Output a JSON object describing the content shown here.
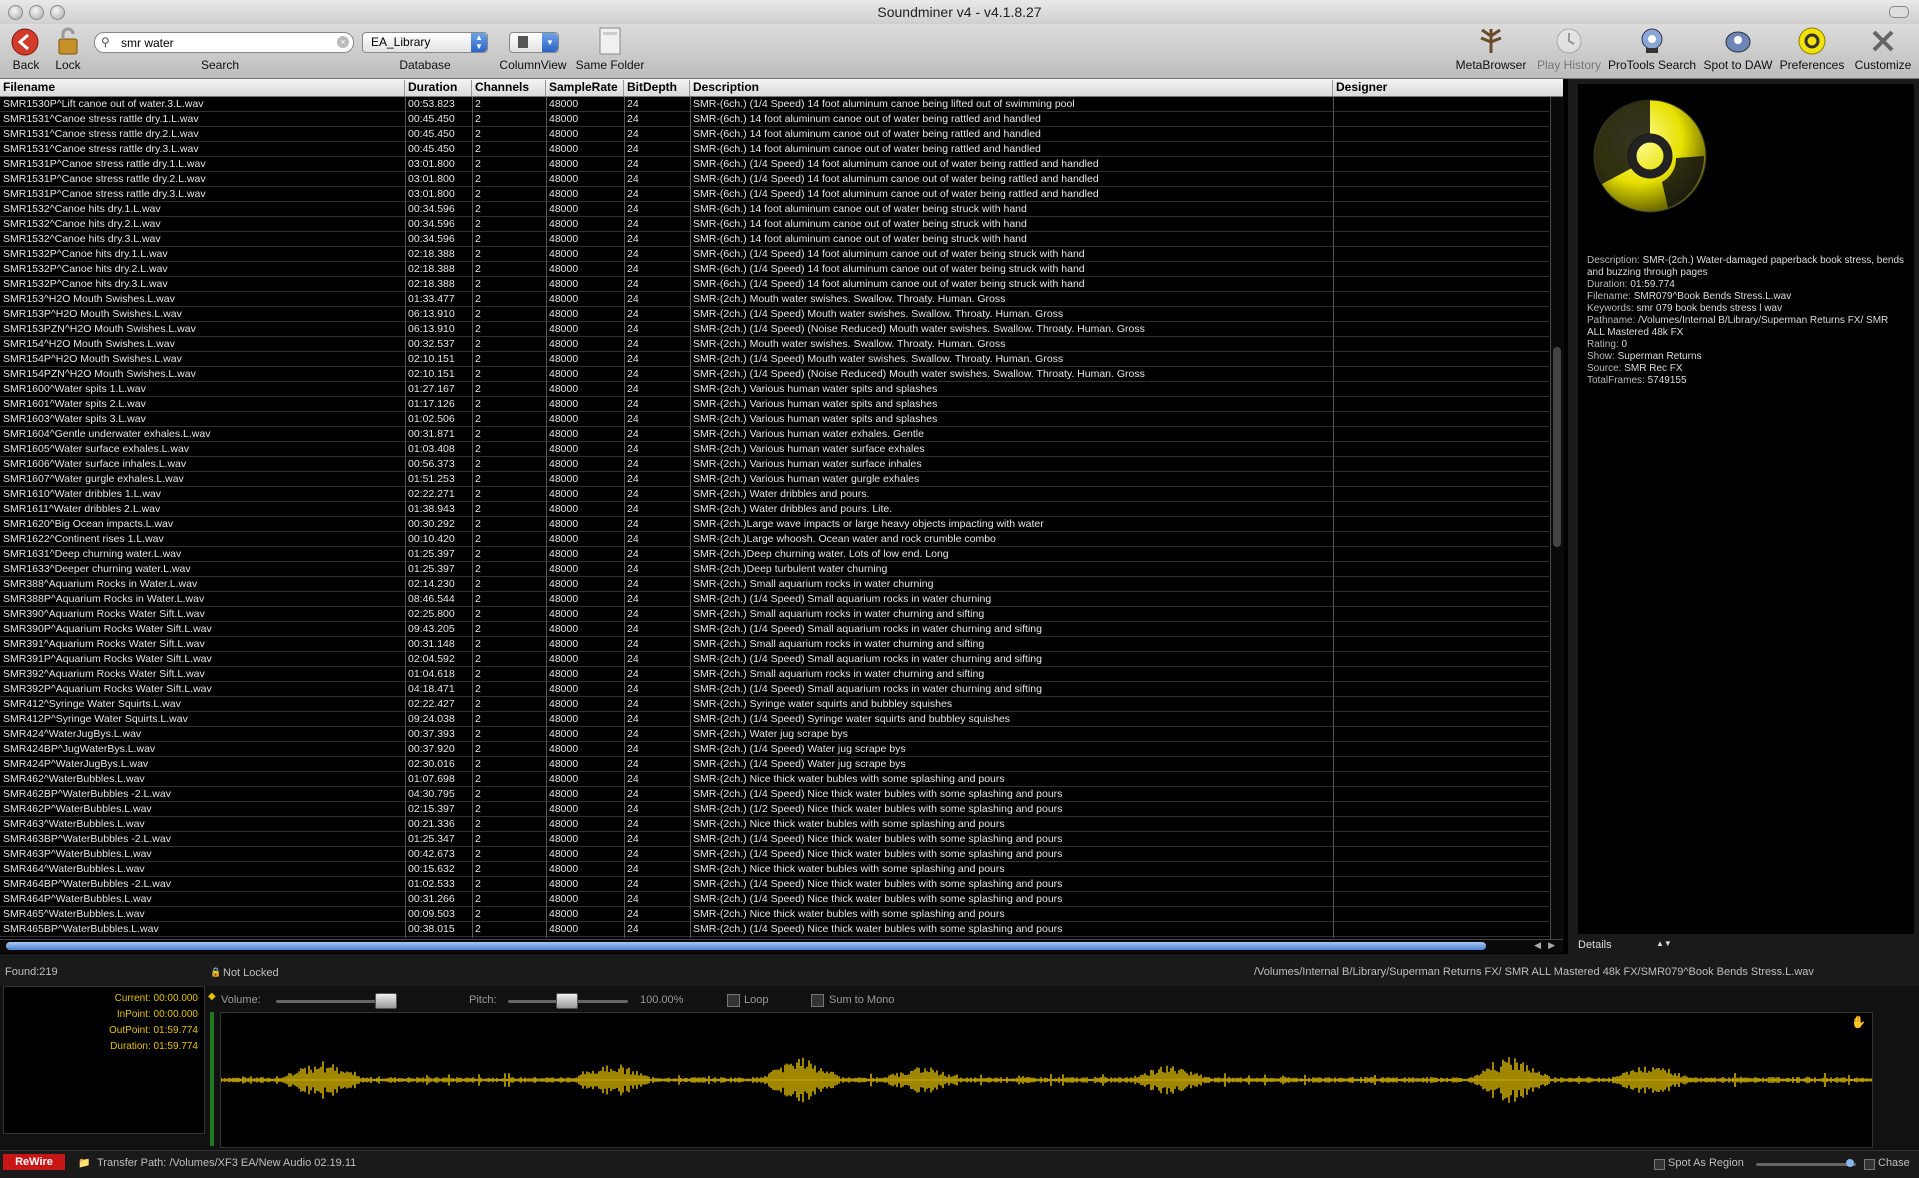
{
  "window": {
    "title": "Soundminer v4 - v4.1.8.27"
  },
  "toolbar": {
    "back_label": "Back",
    "lock_label": "Lock",
    "search_label": "Search",
    "search_value": "smr water",
    "database_label": "Database",
    "database_value": "EA_Library",
    "columnview_label": "ColumnView",
    "samefolder_label": "Same Folder",
    "metabrowser_label": "MetaBrowser",
    "playhistory_label": "Play History",
    "protools_label": "ProTools Search",
    "spottodaw_label": "Spot to DAW",
    "preferences_label": "Preferences",
    "customize_label": "Customize"
  },
  "columns": [
    "Filename",
    "Duration",
    "Channels",
    "SampleRate",
    "BitDepth",
    "Description",
    "Designer"
  ],
  "rows": [
    [
      "SMR1530P^Lift canoe out of water.3.L.wav",
      "00:53.823",
      "2",
      "48000",
      "24",
      "SMR-(6ch.) (1/4 Speed) 14 foot aluminum canoe being lifted out of swimming pool"
    ],
    [
      "SMR1531^Canoe stress rattle dry.1.L.wav",
      "00:45.450",
      "2",
      "48000",
      "24",
      "SMR-(6ch.) 14 foot aluminum canoe out of water being rattled and handled"
    ],
    [
      "SMR1531^Canoe stress rattle dry.2.L.wav",
      "00:45.450",
      "2",
      "48000",
      "24",
      "SMR-(6ch.) 14 foot aluminum canoe out of water being rattled and handled"
    ],
    [
      "SMR1531^Canoe stress rattle dry.3.L.wav",
      "00:45.450",
      "2",
      "48000",
      "24",
      "SMR-(6ch.) 14 foot aluminum canoe out of water being rattled and handled"
    ],
    [
      "SMR1531P^Canoe stress rattle dry.1.L.wav",
      "03:01.800",
      "2",
      "48000",
      "24",
      "SMR-(6ch.) (1/4 Speed) 14 foot aluminum canoe out of water being rattled and handled"
    ],
    [
      "SMR1531P^Canoe stress rattle dry.2.L.wav",
      "03:01.800",
      "2",
      "48000",
      "24",
      "SMR-(6ch.) (1/4 Speed) 14 foot aluminum canoe out of water being rattled and handled"
    ],
    [
      "SMR1531P^Canoe stress rattle dry.3.L.wav",
      "03:01.800",
      "2",
      "48000",
      "24",
      "SMR-(6ch.) (1/4 Speed) 14 foot aluminum canoe out of water being rattled and handled"
    ],
    [
      "SMR1532^Canoe hits dry.1.L.wav",
      "00:34.596",
      "2",
      "48000",
      "24",
      "SMR-(6ch.) 14 foot aluminum canoe out of water being struck with hand"
    ],
    [
      "SMR1532^Canoe hits dry.2.L.wav",
      "00:34.596",
      "2",
      "48000",
      "24",
      "SMR-(6ch.) 14 foot aluminum canoe out of water being struck with hand"
    ],
    [
      "SMR1532^Canoe hits dry.3.L.wav",
      "00:34.596",
      "2",
      "48000",
      "24",
      "SMR-(6ch.) 14 foot aluminum canoe out of water being struck with hand"
    ],
    [
      "SMR1532P^Canoe hits dry.1.L.wav",
      "02:18.388",
      "2",
      "48000",
      "24",
      "SMR-(6ch.) (1/4 Speed) 14 foot aluminum canoe out of water being struck with hand"
    ],
    [
      "SMR1532P^Canoe hits dry.2.L.wav",
      "02:18.388",
      "2",
      "48000",
      "24",
      "SMR-(6ch.) (1/4 Speed) 14 foot aluminum canoe out of water being struck with hand"
    ],
    [
      "SMR1532P^Canoe hits dry.3.L.wav",
      "02:18.388",
      "2",
      "48000",
      "24",
      "SMR-(6ch.) (1/4 Speed) 14 foot aluminum canoe out of water being struck with hand"
    ],
    [
      "SMR153^H2O Mouth Swishes.L.wav",
      "01:33.477",
      "2",
      "48000",
      "24",
      "SMR-(2ch.) Mouth water swishes. Swallow. Throaty. Human. Gross"
    ],
    [
      "SMR153P^H2O Mouth Swishes.L.wav",
      "06:13.910",
      "2",
      "48000",
      "24",
      "SMR-(2ch.) (1/4 Speed) Mouth water swishes. Swallow. Throaty. Human. Gross"
    ],
    [
      "SMR153PZN^H2O Mouth Swishes.L.wav",
      "06:13.910",
      "2",
      "48000",
      "24",
      "SMR-(2ch.) (1/4 Speed) (Noise Reduced) Mouth water swishes. Swallow. Throaty. Human. Gross"
    ],
    [
      "SMR154^H2O Mouth Swishes.L.wav",
      "00:32.537",
      "2",
      "48000",
      "24",
      "SMR-(2ch.) Mouth water swishes. Swallow. Throaty. Human. Gross"
    ],
    [
      "SMR154P^H2O Mouth Swishes.L.wav",
      "02:10.151",
      "2",
      "48000",
      "24",
      "SMR-(2ch.) (1/4 Speed) Mouth water swishes. Swallow. Throaty. Human. Gross"
    ],
    [
      "SMR154PZN^H2O Mouth Swishes.L.wav",
      "02:10.151",
      "2",
      "48000",
      "24",
      "SMR-(2ch.) (1/4 Speed) (Noise Reduced) Mouth water swishes. Swallow. Throaty. Human. Gross"
    ],
    [
      "SMR1600^Water spits 1.L.wav",
      "01:27.167",
      "2",
      "48000",
      "24",
      "SMR-(2ch.) Various human water spits and splashes"
    ],
    [
      "SMR1601^Water spits 2.L.wav",
      "01:17.126",
      "2",
      "48000",
      "24",
      "SMR-(2ch.) Various human water spits and splashes"
    ],
    [
      "SMR1603^Water spits 3.L.wav",
      "01:02.506",
      "2",
      "48000",
      "24",
      "SMR-(2ch.) Various human water spits and splashes"
    ],
    [
      "SMR1604^Gentle underwater exhales.L.wav",
      "00:31.871",
      "2",
      "48000",
      "24",
      "SMR-(2ch.) Various human water exhales. Gentle"
    ],
    [
      "SMR1605^Water surface exhales.L.wav",
      "01:03.408",
      "2",
      "48000",
      "24",
      "SMR-(2ch.) Various human water surface exhales"
    ],
    [
      "SMR1606^Water surface inhales.L.wav",
      "00:56.373",
      "2",
      "48000",
      "24",
      "SMR-(2ch.) Various human water surface inhales"
    ],
    [
      "SMR1607^Water gurgle exhales.L.wav",
      "01:51.253",
      "2",
      "48000",
      "24",
      "SMR-(2ch.) Various human water gurgle exhales"
    ],
    [
      "SMR1610^Water dribbles 1.L.wav",
      "02:22.271",
      "2",
      "48000",
      "24",
      "SMR-(2ch.) Water dribbles and pours."
    ],
    [
      "SMR1611^Water dribbles 2.L.wav",
      "01:38.943",
      "2",
      "48000",
      "24",
      "SMR-(2ch.) Water dribbles and pours. Lite."
    ],
    [
      "SMR1620^Big Ocean impacts.L.wav",
      "00:30.292",
      "2",
      "48000",
      "24",
      "SMR-(2ch.)Large wave impacts or large heavy objects impacting with water"
    ],
    [
      "SMR1622^Continent rises 1.L.wav",
      "00:10.420",
      "2",
      "48000",
      "24",
      "SMR-(2ch.)Large whoosh. Ocean water and rock crumble combo"
    ],
    [
      "SMR1631^Deep churning water.L.wav",
      "01:25.397",
      "2",
      "48000",
      "24",
      "SMR-(2ch.)Deep churning water. Lots of low end. Long"
    ],
    [
      "SMR1633^Deeper churning water.L.wav",
      "01:25.397",
      "2",
      "48000",
      "24",
      "SMR-(2ch.)Deep turbulent water churning"
    ],
    [
      "SMR388^Aquarium Rocks in Water.L.wav",
      "02:14.230",
      "2",
      "48000",
      "24",
      "SMR-(2ch.) Small aquarium rocks in water churning"
    ],
    [
      "SMR388P^Aquarium Rocks in Water.L.wav",
      "08:46.544",
      "2",
      "48000",
      "24",
      "SMR-(2ch.) (1/4 Speed) Small aquarium rocks in water churning"
    ],
    [
      "SMR390^Aquarium Rocks Water Sift.L.wav",
      "02:25.800",
      "2",
      "48000",
      "24",
      "SMR-(2ch.) Small aquarium rocks in water churning and sifting"
    ],
    [
      "SMR390P^Aquarium Rocks Water Sift.L.wav",
      "09:43.205",
      "2",
      "48000",
      "24",
      "SMR-(2ch.) (1/4 Speed) Small aquarium rocks in water churning and sifting"
    ],
    [
      "SMR391^Aquarium Rocks Water Sift.L.wav",
      "00:31.148",
      "2",
      "48000",
      "24",
      "SMR-(2ch.) Small aquarium rocks in water churning and sifting"
    ],
    [
      "SMR391P^Aquarium Rocks Water Sift.L.wav",
      "02:04.592",
      "2",
      "48000",
      "24",
      "SMR-(2ch.) (1/4 Speed) Small aquarium rocks in water churning and sifting"
    ],
    [
      "SMR392^Aquarium Rocks Water Sift.L.wav",
      "01:04.618",
      "2",
      "48000",
      "24",
      "SMR-(2ch.) Small aquarium rocks in water churning and sifting"
    ],
    [
      "SMR392P^Aquarium Rocks Water Sift.L.wav",
      "04:18.471",
      "2",
      "48000",
      "24",
      "SMR-(2ch.) (1/4 Speed) Small aquarium rocks in water churning and sifting"
    ],
    [
      "SMR412^Syringe Water Squirts.L.wav",
      "02:22.427",
      "2",
      "48000",
      "24",
      "SMR-(2ch.) Syringe water squirts and bubbley squishes"
    ],
    [
      "SMR412P^Syringe Water Squirts.L.wav",
      "09:24.038",
      "2",
      "48000",
      "24",
      "SMR-(2ch.) (1/4 Speed) Syringe water squirts and bubbley squishes"
    ],
    [
      "SMR424^WaterJugBys.L.wav",
      "00:37.393",
      "2",
      "48000",
      "24",
      "SMR-(2ch.) Water jug scrape bys"
    ],
    [
      "SMR424BP^JugWaterBys.L.wav",
      "00:37.920",
      "2",
      "48000",
      "24",
      "SMR-(2ch.) (1/4 Speed) Water jug scrape bys"
    ],
    [
      "SMR424P^WaterJugBys.L.wav",
      "02:30.016",
      "2",
      "48000",
      "24",
      "SMR-(2ch.) (1/4 Speed) Water jug scrape bys"
    ],
    [
      "SMR462^WaterBubbles.L.wav",
      "01:07.698",
      "2",
      "48000",
      "24",
      "SMR-(2ch.) Nice thick water bubles with some splashing and pours"
    ],
    [
      "SMR462BP^WaterBubbles -2.L.wav",
      "04:30.795",
      "2",
      "48000",
      "24",
      "SMR-(2ch.) (1/4 Speed) Nice thick water bubles with some splashing and pours"
    ],
    [
      "SMR462P^WaterBubbles.L.wav",
      "02:15.397",
      "2",
      "48000",
      "24",
      "SMR-(2ch.) (1/2 Speed) Nice thick water bubles with some splashing and pours"
    ],
    [
      "SMR463^WaterBubbles.L.wav",
      "00:21.336",
      "2",
      "48000",
      "24",
      "SMR-(2ch.) Nice thick water bubles with some splashing and pours"
    ],
    [
      "SMR463BP^WaterBubbles -2.L.wav",
      "01:25.347",
      "2",
      "48000",
      "24",
      "SMR-(2ch.) (1/4 Speed) Nice thick water bubles with some splashing and pours"
    ],
    [
      "SMR463P^WaterBubbles.L.wav",
      "00:42.673",
      "2",
      "48000",
      "24",
      "SMR-(2ch.) (1/4 Speed) Nice thick water bubles with some splashing and pours"
    ],
    [
      "SMR464^WaterBubbles.L.wav",
      "00:15.632",
      "2",
      "48000",
      "24",
      "SMR-(2ch.) Nice thick water bubles with some splashing and pours"
    ],
    [
      "SMR464BP^WaterBubbles -2.L.wav",
      "01:02.533",
      "2",
      "48000",
      "24",
      "SMR-(2ch.) (1/4 Speed) Nice thick water bubles with some splashing and pours"
    ],
    [
      "SMR464P^WaterBubbles.L.wav",
      "00:31.266",
      "2",
      "48000",
      "24",
      "SMR-(2ch.) (1/4 Speed) Nice thick water bubles with some splashing and pours"
    ],
    [
      "SMR465^WaterBubbles.L.wav",
      "00:09.503",
      "2",
      "48000",
      "24",
      "SMR-(2ch.) Nice thick water bubles with some splashing and pours"
    ],
    [
      "SMR465BP^WaterBubbles.L.wav",
      "00:38.015",
      "2",
      "48000",
      "24",
      "SMR-(2ch.) (1/4 Speed) Nice thick water bubles with some splashing and pours"
    ]
  ],
  "details": {
    "select_label": "Details",
    "fields": [
      {
        "k": "Description:",
        "v": "SMR-(2ch.) Water-damaged paperback book stress, bends and buzzing through pages"
      },
      {
        "k": "Duration:",
        "v": "01:59.774"
      },
      {
        "k": "Filename:",
        "v": "SMR079^Book Bends Stress.L.wav"
      },
      {
        "k": "Keywords:",
        "v": "smr 079 book bends stress l wav"
      },
      {
        "k": "Pathname:",
        "v": "/Volumes/Internal B/Library/Superman Returns FX/ SMR ALL Mastered 48k FX"
      },
      {
        "k": "Rating:",
        "v": "0"
      },
      {
        "k": "Show:",
        "v": "Superman Returns"
      },
      {
        "k": "Source:",
        "v": "SMR Rec FX"
      },
      {
        "k": "TotalFrames:",
        "v": "5749155"
      }
    ]
  },
  "status": {
    "found": "Found:219",
    "lock_state": "Not Locked",
    "path": "/Volumes/Internal B/Library/Superman Returns FX/ SMR ALL Mastered 48k FX/SMR079^Book Bends Stress.L.wav"
  },
  "player": {
    "current": "Current: 00:00.000",
    "inpoint": "InPoint: 00:00.000",
    "outpoint": "OutPoint: 01:59.774",
    "duration": "Duration: 01:59.774",
    "volume_label": "Volume:",
    "pitch_label": "Pitch:",
    "pitch_value": "100.00%",
    "loop_label": "Loop",
    "sum_label": "Sum to Mono"
  },
  "bottom": {
    "rewire": "ReWire",
    "transfer_path": "Transfer Path: /Volumes/XF3 EA/New Audio 02.19.11",
    "spot_region": "Spot As Region",
    "chase": "Chase"
  },
  "colors": {
    "accent": "#e5c100",
    "selection": "#4b83d1",
    "rewire": "#c81616"
  }
}
